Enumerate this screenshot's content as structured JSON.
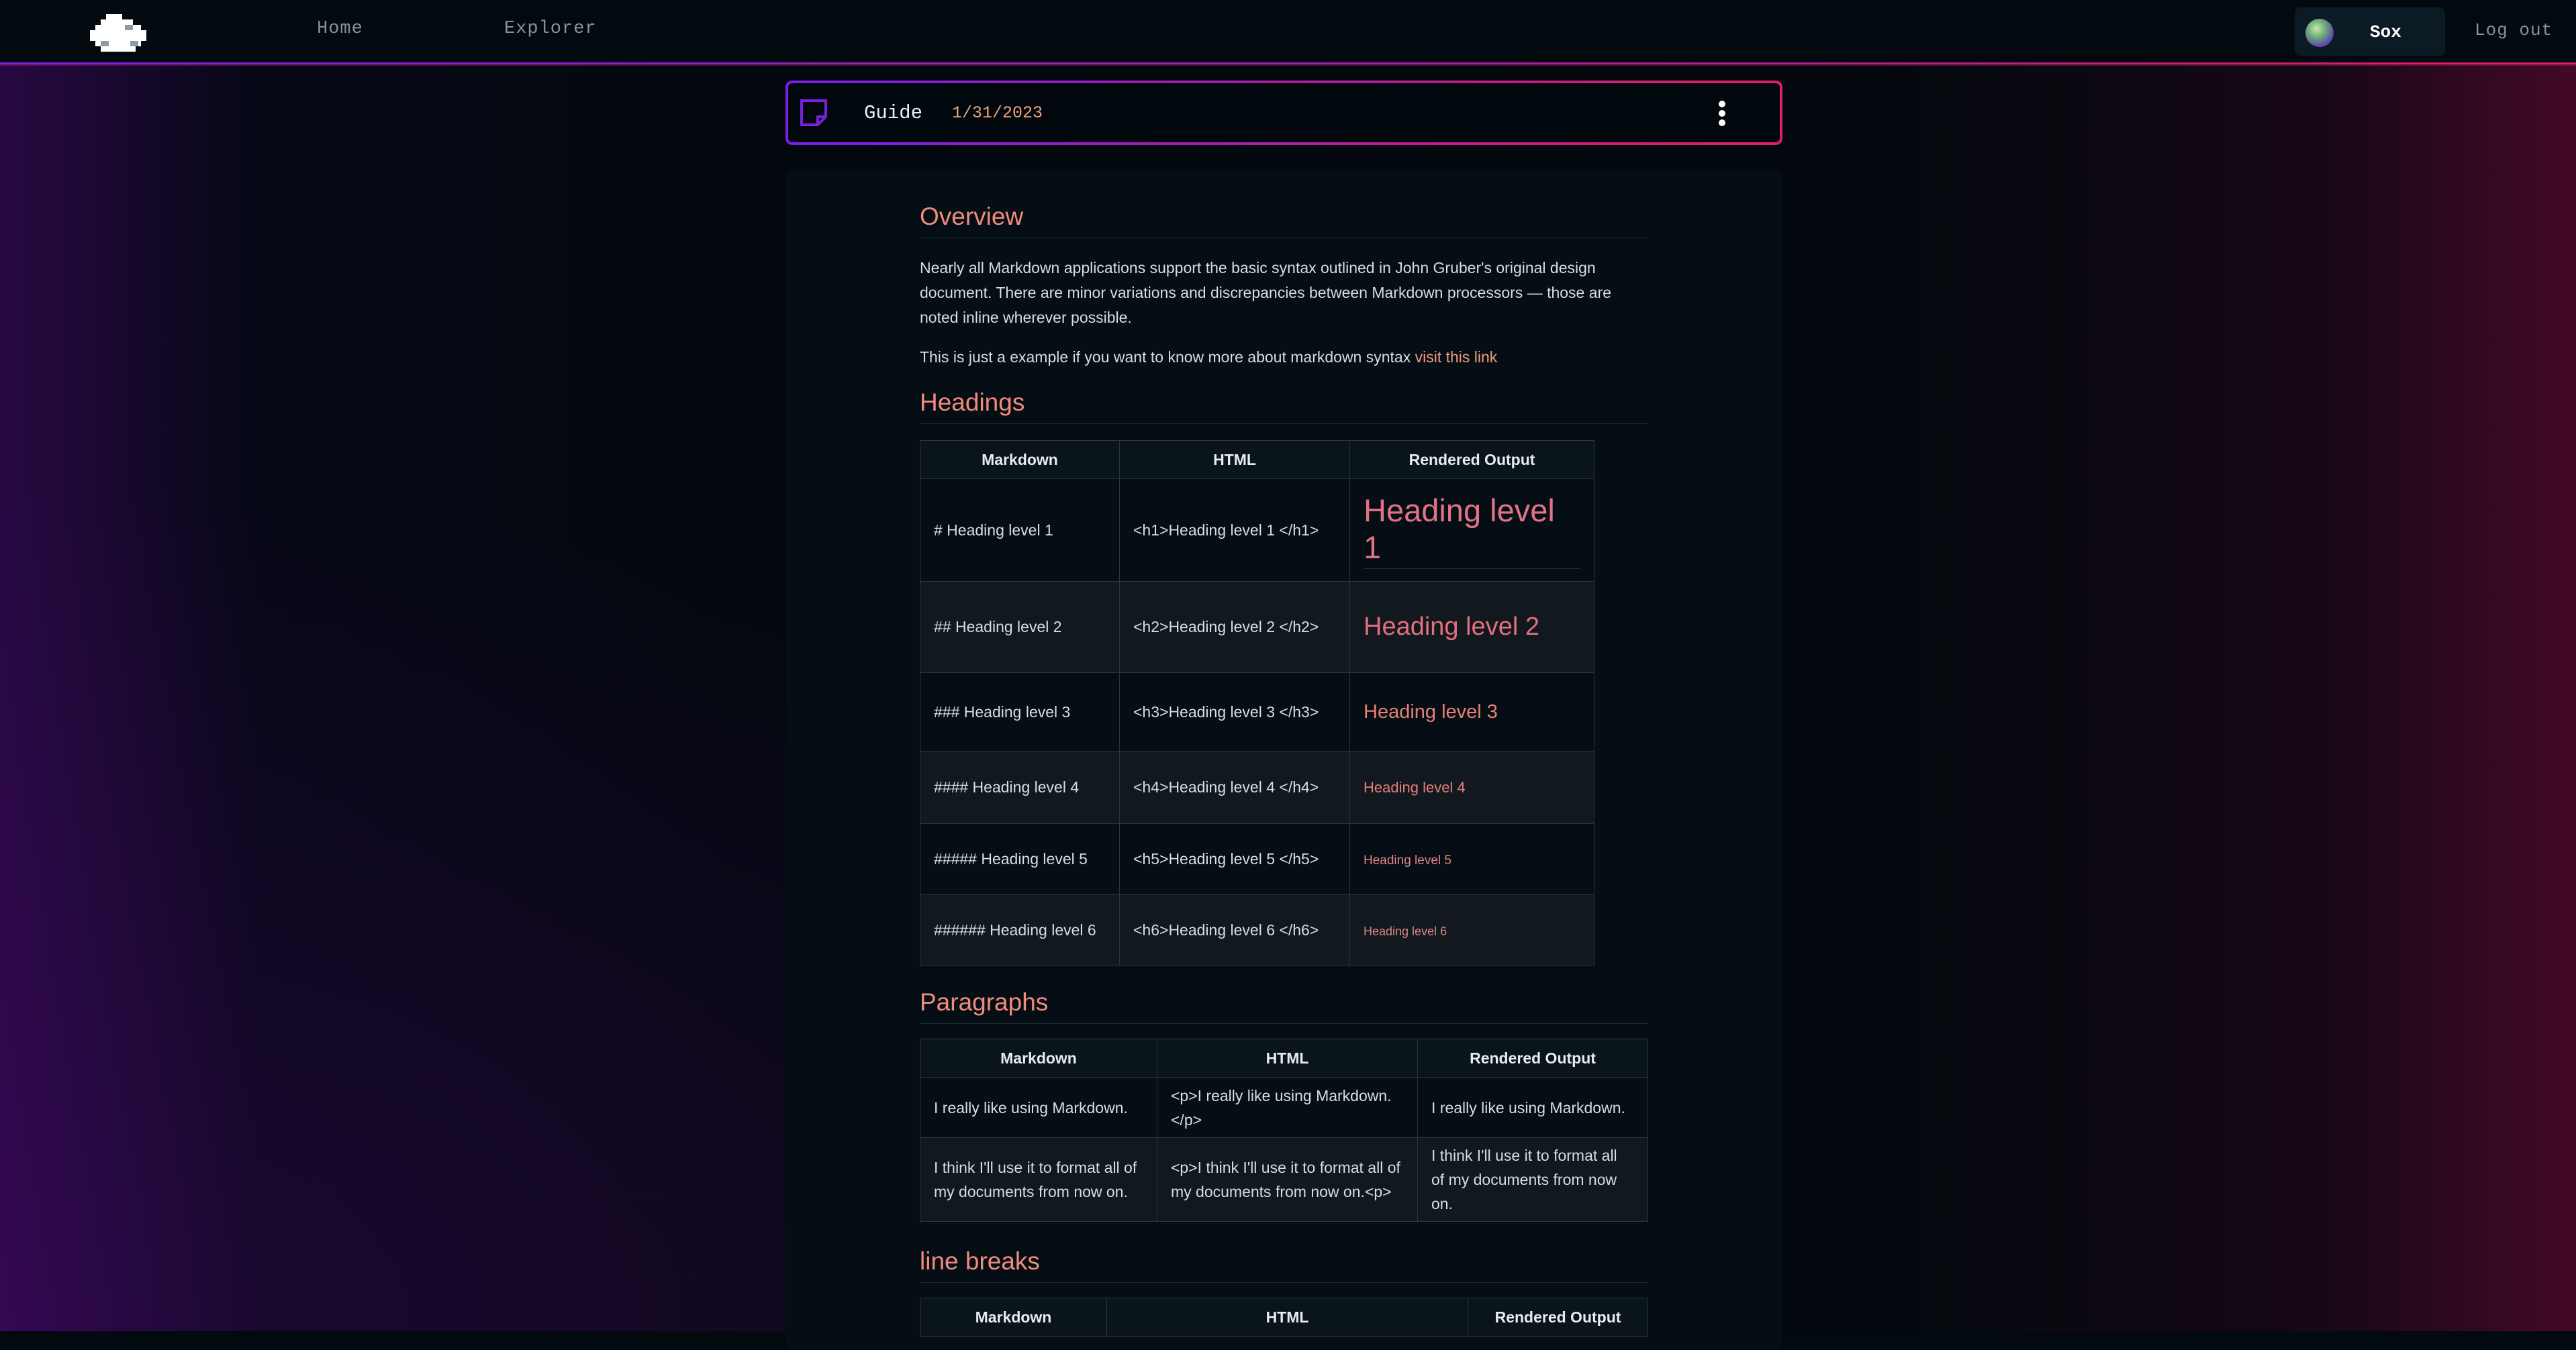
{
  "nav": {
    "home": "Home",
    "explorer": "Explorer",
    "user_name": "Sox",
    "logout": "Log out"
  },
  "doc": {
    "title": "Guide",
    "date": "1/31/2023"
  },
  "overview": {
    "heading": "Overview",
    "para1": "Nearly all Markdown applications support the basic syntax outlined in John Gruber's original design document. There are minor variations and discrepancies between Markdown processors — those are noted inline wherever possible.",
    "para2_text": "This is just a example if you want to know more about markdown syntax ",
    "para2_link": "visit this link"
  },
  "headings": {
    "heading": "Headings",
    "columns": [
      "Markdown",
      "HTML",
      "Rendered Output"
    ],
    "rows": [
      {
        "md": "# Heading level 1",
        "html": "<h1>Heading level 1 </h1>",
        "out": "Heading level 1"
      },
      {
        "md": "## Heading level 2",
        "html": "<h2>Heading level 2 </h2>",
        "out": "Heading level 2"
      },
      {
        "md": "### Heading level 3",
        "html": "<h3>Heading level 3 </h3>",
        "out": "Heading level 3"
      },
      {
        "md": "#### Heading level 4",
        "html": "<h4>Heading level 4 </h4>",
        "out": "Heading level 4"
      },
      {
        "md": "##### Heading level 5",
        "html": "<h5>Heading level 5 </h5>",
        "out": "Heading level 5"
      },
      {
        "md": "###### Heading level 6",
        "html": "<h6>Heading level 6 </h6>",
        "out": "Heading level 6"
      }
    ]
  },
  "paragraphs": {
    "heading": "Paragraphs",
    "columns": [
      "Markdown",
      "HTML",
      "Rendered Output"
    ],
    "rows": [
      {
        "md": "I really like using Markdown.",
        "html": "<p>I really like using Markdown.</p>",
        "out": "I really like using Markdown."
      },
      {
        "md": "I think I'll use it to format all of my documents from now on.",
        "html": "<p>I think I'll use it to format all of my documents from now on.<p>",
        "out": "I think I'll use it to format all of my documents from now on."
      }
    ]
  },
  "line_breaks": {
    "heading": "line breaks",
    "columns": [
      "Markdown",
      "HTML",
      "Rendered Output"
    ]
  },
  "colors": {
    "accent_purple": "#7b1fe0",
    "accent_pink": "#e01e62",
    "heading": "#f08b7c",
    "date": "#f2a176"
  },
  "icons": [
    "cloud-logo-icon",
    "note-icon",
    "kebab-menu-icon"
  ]
}
